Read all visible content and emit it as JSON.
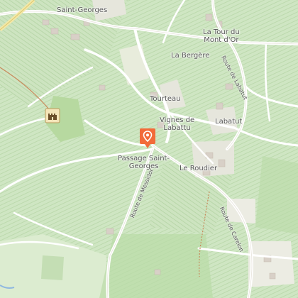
{
  "map": {
    "places": {
      "saint_georges": "Saint-Georges",
      "la_tour_line1": "La Tour du",
      "la_tour_line2": "Mont d'Or",
      "la_bergere": "La Bergère",
      "tourteau": "Tourteau",
      "vignes_line1": "Vignes de",
      "vignes_line2": "Labattu",
      "labatut": "Labatut",
      "passage_line1": "Passage Saint-",
      "passage_line2": "Georges",
      "le_roudier": "Le Roudier"
    },
    "roads": {
      "route_labatut": "Route de Labatut",
      "route_messidor": "Route de Messidor",
      "route_carelon": "Route de Carelon"
    },
    "icons": {
      "marker": "location-pin-icon",
      "poi": "chateau-icon"
    },
    "colors": {
      "vineyard": "#cfe6c3",
      "road": "#ffffff",
      "marker": "#f26b3a"
    }
  }
}
